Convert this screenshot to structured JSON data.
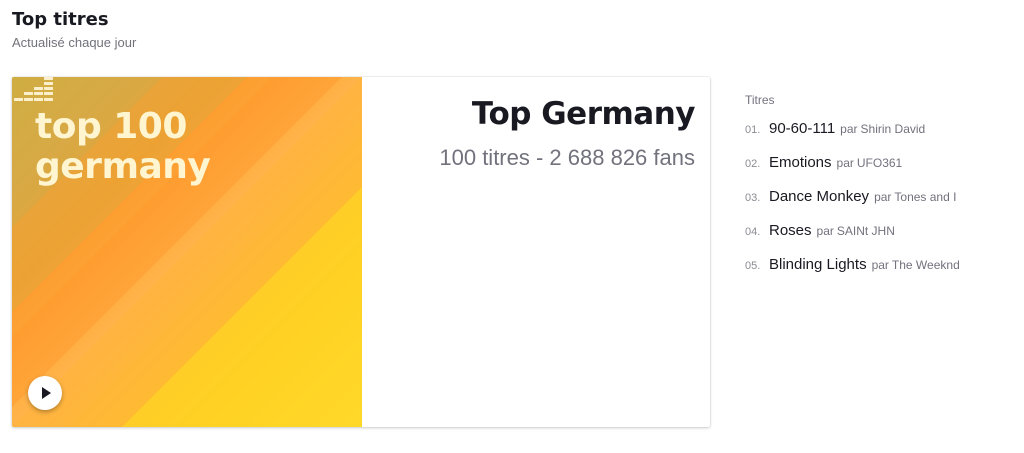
{
  "section": {
    "title": "Top titres",
    "subtitle": "Actualisé chaque jour"
  },
  "playlist": {
    "cover_line1": "top 100",
    "cover_line2": "germany",
    "title": "Top Germany",
    "meta": "100 titres - 2 688 826 fans"
  },
  "tracks": {
    "header": "Titres",
    "by_label": "par",
    "items": [
      {
        "num": "01.",
        "title": "90-60-111",
        "artist": "Shirin David"
      },
      {
        "num": "02.",
        "title": "Emotions",
        "artist": "UFO361"
      },
      {
        "num": "03.",
        "title": "Dance Monkey",
        "artist": "Tones and I"
      },
      {
        "num": "04.",
        "title": "Roses",
        "artist": "SAINt JHN"
      },
      {
        "num": "05.",
        "title": "Blinding Lights",
        "artist": "The Weeknd"
      }
    ]
  },
  "icons": {
    "play": "play-icon",
    "logo": "deezer-logo-icon"
  },
  "colors": {
    "cover_gradient": [
      "#c9ae45",
      "#f79a2c",
      "#ffc02e",
      "#ffe033"
    ],
    "cover_text": "#fff5d0",
    "title": "#191922",
    "muted": "#72727d"
  }
}
